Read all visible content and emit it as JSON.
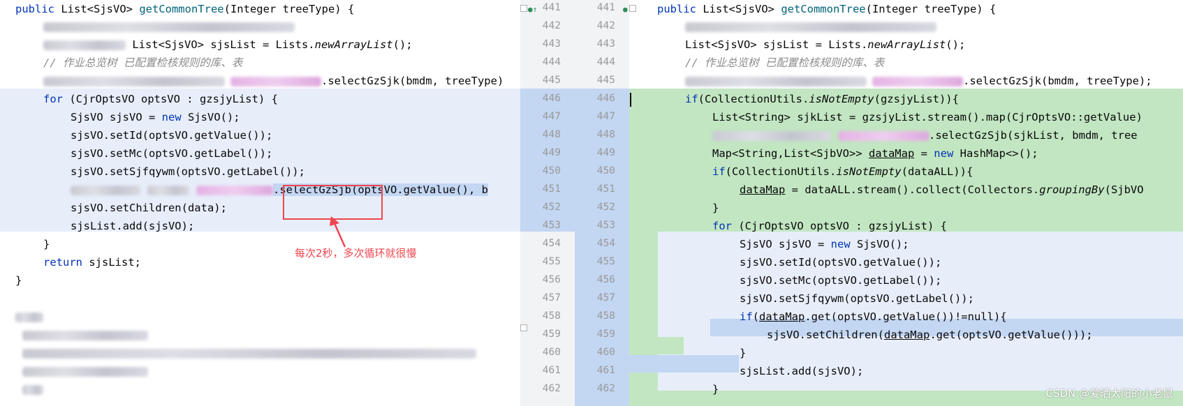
{
  "left": {
    "lines": [
      {
        "text_a": "public ",
        "text_b": "List<SjsVO> ",
        "fn": "getCommonTree",
        "text_c": "(Integer treeType) {"
      },
      {
        "redacted": "String bmdm = ..."
      },
      {
        "text": "List<SjsVO> sjsList = Lists.",
        "it": "newArrayList",
        "rest": "();"
      },
      {
        "comment": "// 作业总览树 已配置检核规则的库、表"
      },
      {
        "rest2": ".selectGzSjk(bmdm, treeType)"
      },
      {
        "for_kw": "for",
        "for_rest": " (CjrOptsVO optsVO : gzsjyList) {"
      },
      {
        "t1": "SjsVO sjsVO = ",
        "new": "new",
        "t2": " SjsVO();"
      },
      {
        "code": "sjsVO.setId(optsVO.getValue());"
      },
      {
        "code": "sjsVO.setMc(optsVO.getLabel());"
      },
      {
        "code": "sjsVO.setSjfqywm(optsVO.getLabel());"
      },
      {
        "code": ".selectGzSjb(optsVO.getValue(), b"
      },
      {
        "code": "sjsVO.setChildren(data);"
      },
      {
        "code": "sjsList.add(sjsVO);"
      },
      {
        "code": "}"
      },
      {
        "ret": "return",
        "code": " sjsList;"
      },
      {
        "code": "}"
      }
    ]
  },
  "annotation": "每次2秒，多次循环就很慢",
  "gutter": {
    "numbers": [
      "441",
      "442",
      "443",
      "444",
      "445",
      "446",
      "447",
      "448",
      "449",
      "450",
      "451",
      "452",
      "453",
      "454",
      "455",
      "456",
      "457",
      "458",
      "459",
      "460",
      "461",
      "462"
    ]
  },
  "right": {
    "l441": {
      "a": "public ",
      "b": "List<SjsVO> ",
      "fn": "getCommonTree",
      "c": "(Integer treeType) {"
    },
    "l443": {
      "a": "List<SjsVO> sjsList = Lists.",
      "it": "newArrayList",
      "c": "();"
    },
    "l444": "// 作业总览树 已配置检核规则的库、表",
    "l445": ".selectGzSjk(bmdm, treeType);",
    "l446": {
      "kw": "if",
      "a": "(CollectionUtils.",
      "it": "isNotEmpty",
      "c": "(gzsjyList)){"
    },
    "l447": "List<String> sjkList = gzsjyList.stream().map(CjrOptsVO::getValue)",
    "l448": ".selectGzSjb(sjkList, bmdm, tree",
    "l449": {
      "a": "Map<String,List<SjbVO>> ",
      "ul": "dataMap",
      "b": " = ",
      "kw": "new",
      "c": " HashMap<>();"
    },
    "l450": {
      "kw": "if",
      "a": "(CollectionUtils.",
      "it": "isNotEmpty",
      "c": "(dataALL)){"
    },
    "l451": {
      "ul": "dataMap",
      "a": " = dataALL.stream().collect(Collectors.",
      "it": "groupingBy",
      "c": "(SjbVO"
    },
    "l452": "}",
    "l453": {
      "kw": "for",
      "a": " (CjrOptsVO optsVO : gzsjyList) {"
    },
    "l454": {
      "a": "SjsVO sjsVO = ",
      "kw": "new",
      "c": " SjsVO();"
    },
    "l455": "sjsVO.setId(optsVO.getValue());",
    "l456": "sjsVO.setMc(optsVO.getLabel());",
    "l457": "sjsVO.setSjfqywm(optsVO.getLabel());",
    "l458": {
      "kw": "if",
      "a": "(",
      "ul": "dataMap",
      "c": ".get(optsVO.getValue())!=null){"
    },
    "l459": {
      "a": "sjsVO.setChildren(",
      "ul": "dataMap",
      "c": ".get(optsVO.getValue()));"
    },
    "l460": "}",
    "l461": "sjsList.add(sjsVO);",
    "l462": "}"
  },
  "watermark": "CSDN @爱晒太阳的小老鼠",
  "colors": {
    "blue_band": "#e7eefa",
    "green_band": "#c2e6c2",
    "gutter_blue": "#c3d6f2",
    "red": "#f0454f"
  }
}
